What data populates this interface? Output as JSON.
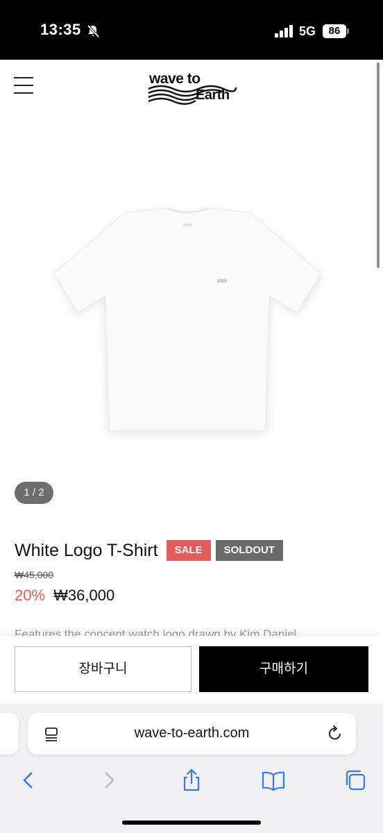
{
  "status_bar": {
    "time": "13:35",
    "network": "5G",
    "battery": "86",
    "icons": [
      "bell-slash-icon",
      "signal-icon"
    ]
  },
  "header": {
    "menu_icon": "hamburger-icon",
    "logo_line1": "wave to",
    "logo_line2": "Earth"
  },
  "gallery": {
    "pager": "1 / 2",
    "image": "white-tshirt"
  },
  "product": {
    "title": "White Logo T-Shirt",
    "badges": [
      "SALE",
      "SOLDOUT"
    ],
    "original_price": "₩45,000",
    "discount": "20%",
    "price": "₩36,000",
    "description_peek": "Features the concept watch logo drawn by Kim Daniel"
  },
  "actions": {
    "cart_label": "장바구니",
    "buy_label": "구매하기"
  },
  "browser": {
    "url": "wave-to-earth.com",
    "toolbar_icons": [
      "back-icon",
      "forward-icon",
      "share-icon",
      "bookmarks-icon",
      "tabs-icon"
    ]
  },
  "colors": {
    "sale": "#e25c5c",
    "soldout": "#6a6a6a",
    "buy_button": "#000000",
    "ios_blue": "#3478f6"
  }
}
